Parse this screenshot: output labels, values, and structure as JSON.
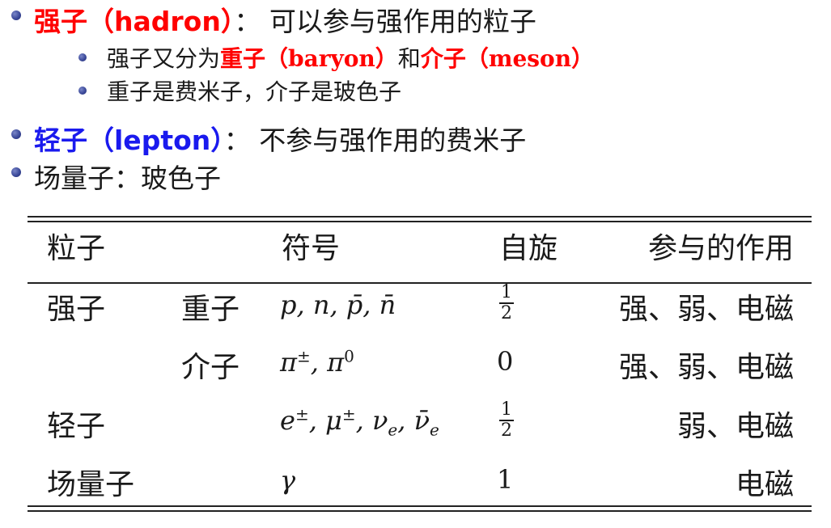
{
  "bullets": {
    "hadron": {
      "term": "强子（hadron）",
      "sep": "：",
      "desc": "可以参与强作用的粒子",
      "sub": [
        {
          "pre": "强子又分为",
          "baryon": "重子（baryon）",
          "mid": "和",
          "meson": "介子（meson）"
        },
        {
          "text": "重子是费米子，介子是玻色子"
        }
      ]
    },
    "lepton": {
      "term": "轻子（lepton）",
      "sep": "：",
      "desc": "不参与强作用的费米子"
    },
    "boson": {
      "text": "场量子：玻色子"
    }
  },
  "table": {
    "headers": {
      "particle": "粒子",
      "symbol": "符号",
      "spin": "自旋",
      "interaction": "参与的作用"
    },
    "rows": [
      {
        "category": "强子",
        "sub": "重子",
        "symbol": "p, n, p̄, n̄",
        "spin_num": "1",
        "spin_den": "2",
        "interaction": "强、弱、电磁"
      },
      {
        "category": "",
        "sub": "介子",
        "symbol": "π±, π0",
        "spin": "0",
        "interaction": "强、弱、电磁"
      },
      {
        "category": "轻子",
        "sub": "",
        "symbol": "e±, μ±, νe, ν̄e",
        "spin_num": "1",
        "spin_den": "2",
        "interaction": "弱、电磁"
      },
      {
        "category": "场量子",
        "sub": "",
        "symbol": "γ",
        "spin": "1",
        "interaction": "电磁"
      }
    ]
  }
}
